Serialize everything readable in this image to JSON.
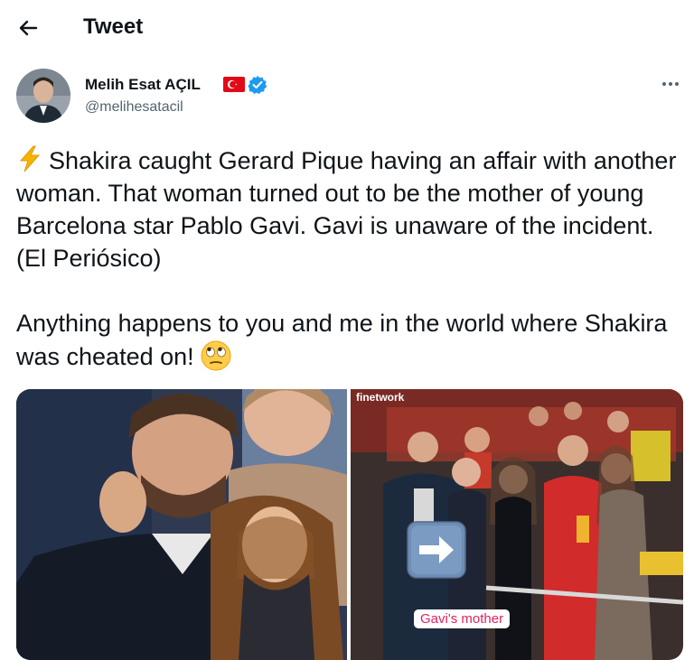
{
  "header": {
    "title": "Tweet",
    "back_icon": "arrow-left-icon"
  },
  "author": {
    "name": "Melih Esat AÇIL",
    "handle": "@melihesatacil",
    "flag_icon": "turkey-flag-icon",
    "verified_icon": "verified-badge-icon",
    "more_icon": "more-dots-icon"
  },
  "tweet": {
    "paragraph_1": "Shakira caught Gerard Pique having an affair with another woman. That woman turned out to be the mother of young Barcelona star Pablo Gavi. Gavi is unaware of the incident. (El Periósico)",
    "paragraph_2": "Anything happens to you and me in the world where Shakira was cheated on!",
    "lead_emoji": "high-voltage-icon",
    "end_emoji": "face-with-rolling-eyes-icon"
  },
  "media": {
    "right_photo": {
      "watermark": "finetwork",
      "label": "Gavi's mother",
      "arrow_icon": "right-arrow-icon"
    }
  },
  "colors": {
    "text": "#0f1419",
    "secondary": "#536471",
    "verified": "#1d9bf0",
    "label": "#e0245e"
  }
}
